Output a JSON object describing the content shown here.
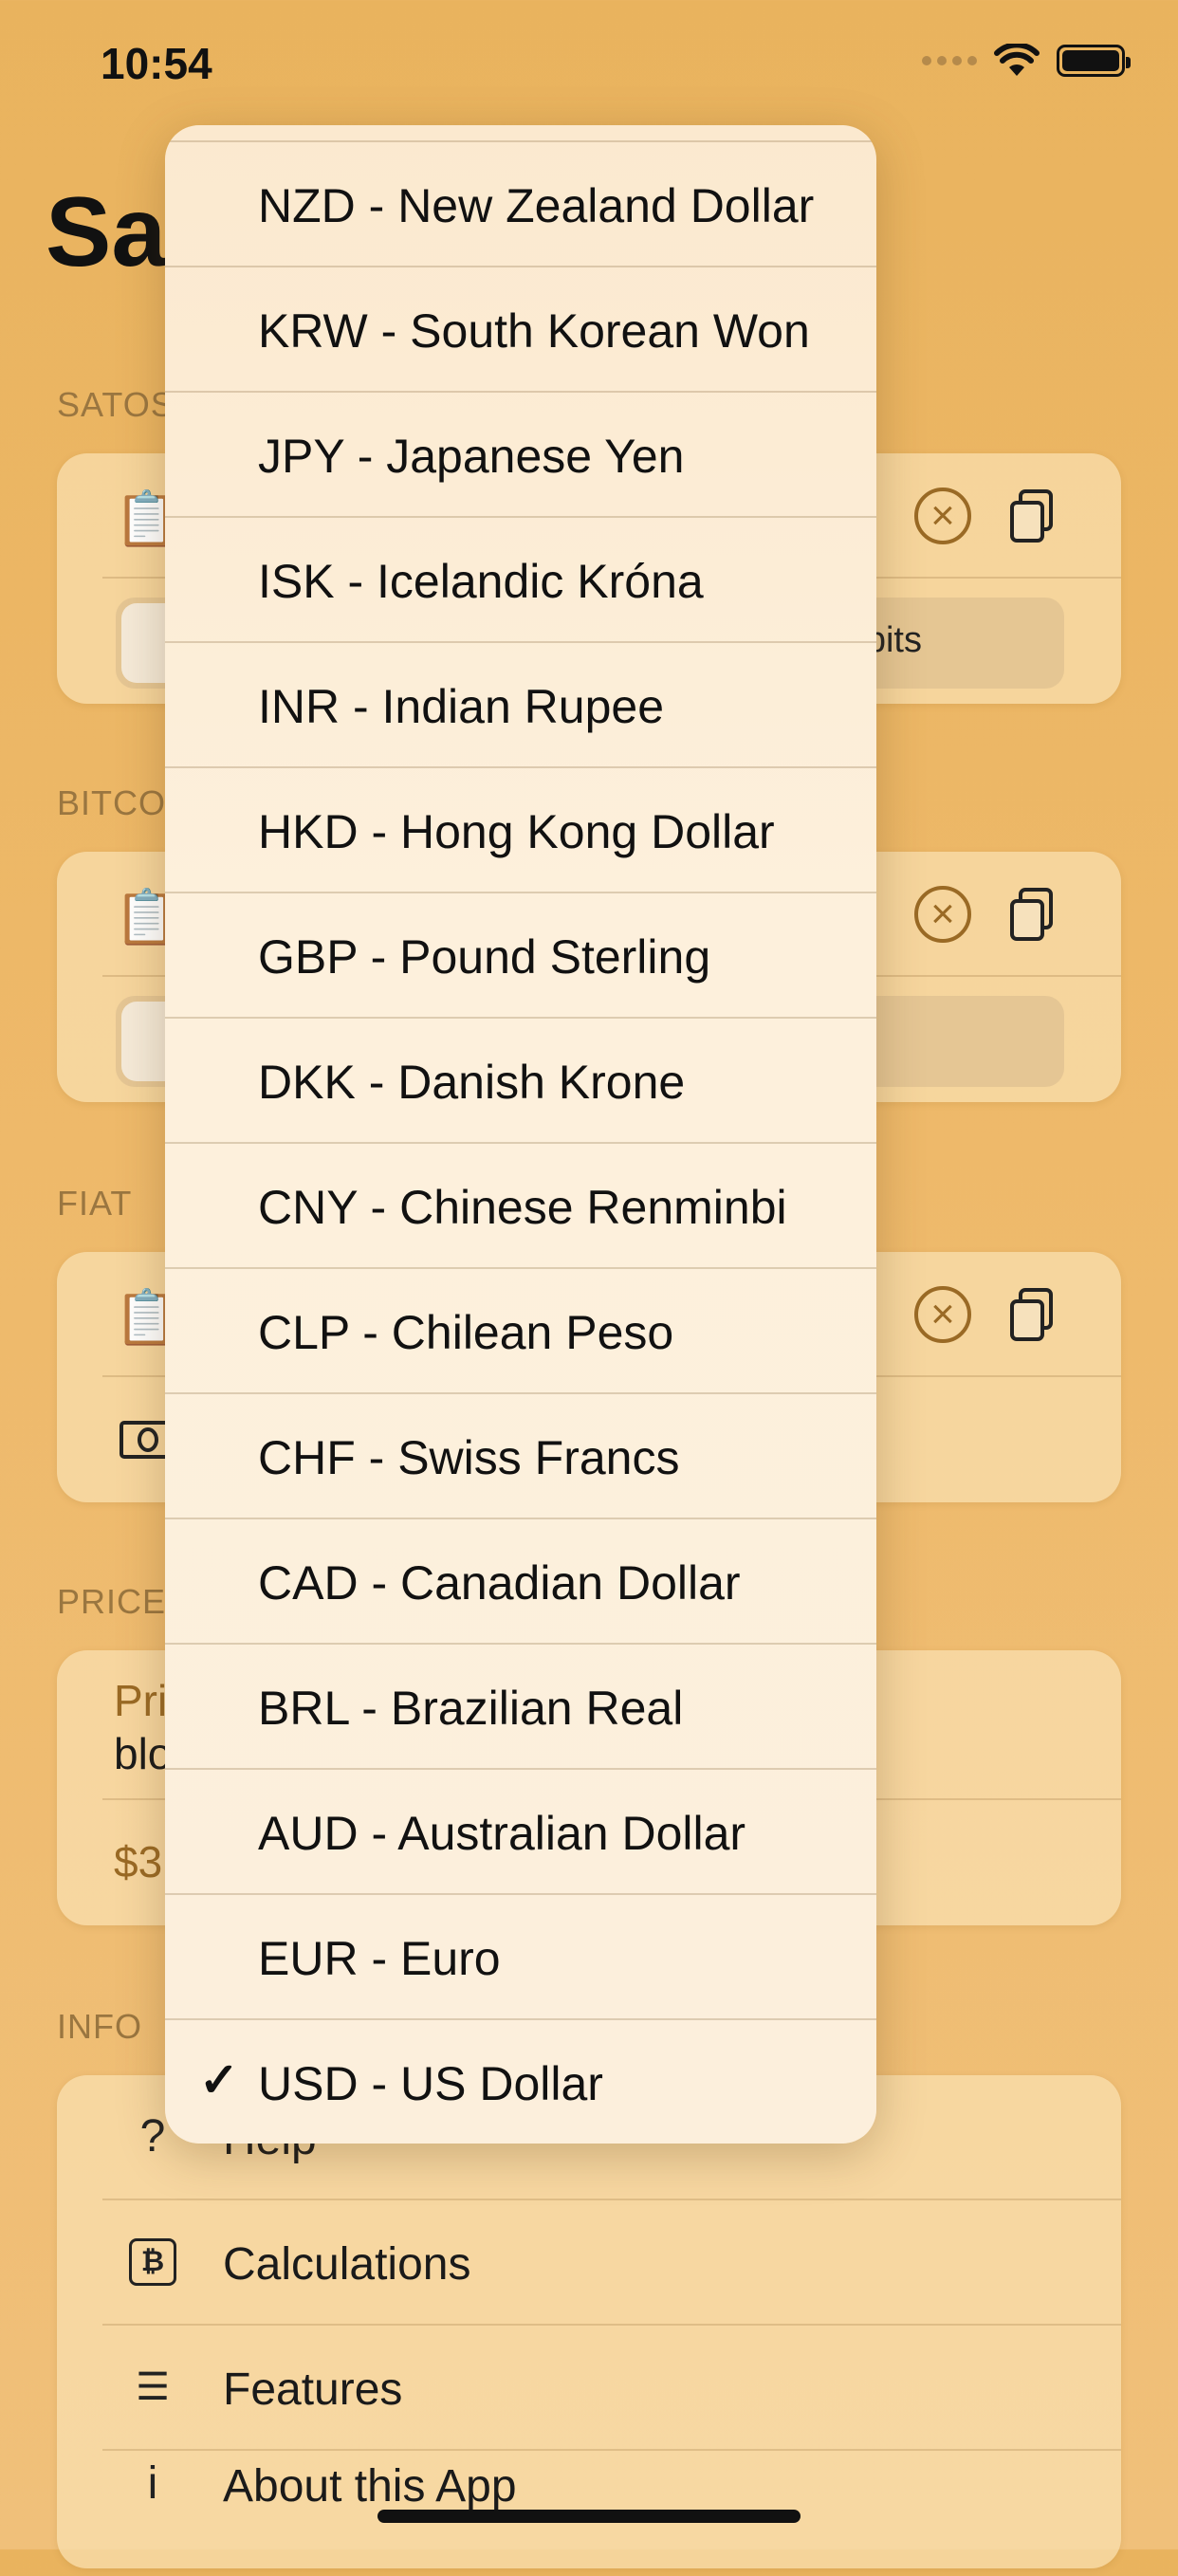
{
  "status": {
    "time": "10:54"
  },
  "screen": {
    "title": "Sa"
  },
  "sections": {
    "satoshis": "SATOS",
    "bitcoin": "BITCO",
    "fiat": "FIAT",
    "price": "PRICE",
    "info": "INFO"
  },
  "satoshis_card": {
    "segment_label": "bits"
  },
  "price_card": {
    "line1": "Pri",
    "line2": "blo",
    "value": "$3"
  },
  "info": {
    "items": [
      {
        "label": "Help",
        "icon": "question-icon"
      },
      {
        "label": "Calculations",
        "icon": "bitcoin-box-icon"
      },
      {
        "label": "Features",
        "icon": "list-icon"
      },
      {
        "label": "About this App",
        "icon": "info-icon"
      }
    ]
  },
  "currency_menu": {
    "selected": "USD - US Dollar",
    "items": [
      "NZD - New Zealand Dollar",
      "KRW - South Korean Won",
      "JPY - Japanese Yen",
      "ISK - Icelandic Króna",
      "INR - Indian Rupee",
      "HKD - Hong Kong Dollar",
      "GBP - Pound Sterling",
      "DKK - Danish Krone",
      "CNY - Chinese Renminbi",
      "CLP - Chilean Peso",
      "CHF - Swiss Francs",
      "CAD - Canadian Dollar",
      "BRL - Brazilian Real",
      "AUD - Australian Dollar",
      "EUR - Euro",
      "USD - US Dollar"
    ]
  },
  "colors": {
    "accent": "#9a6a25",
    "background": "#e9b35e",
    "menu": "#fdf0dc"
  }
}
